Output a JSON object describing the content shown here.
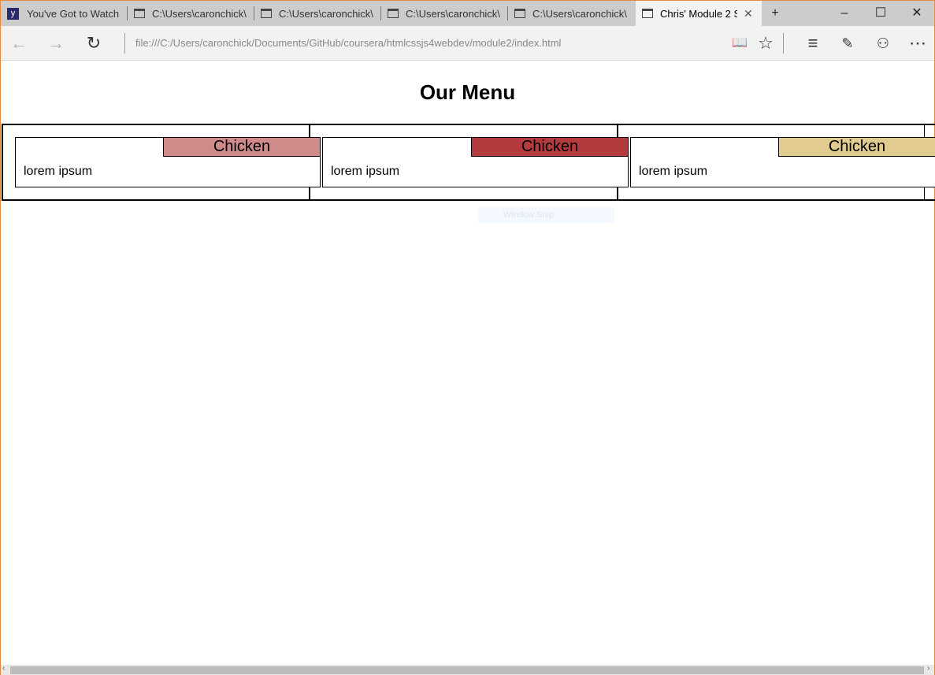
{
  "browser": {
    "tabs": [
      {
        "label": "You've Got to Watch",
        "icon": "site-favicon"
      },
      {
        "label": "C:\\Users\\caronchick\\",
        "icon": "window-icon"
      },
      {
        "label": "C:\\Users\\caronchick\\",
        "icon": "window-icon"
      },
      {
        "label": "C:\\Users\\caronchick\\",
        "icon": "window-icon"
      },
      {
        "label": "C:\\Users\\caronchick\\",
        "icon": "window-icon"
      },
      {
        "label": "Chris' Module 2 S",
        "icon": "window-icon",
        "active": true
      }
    ],
    "new_tab": "+",
    "window_controls": {
      "minimize": "–",
      "maximize": "☐",
      "close": "✕"
    },
    "url": "file:///C:/Users/caronchick/Documents/GitHub/coursera/htmlcssjs4webdev/module2/index.html",
    "nav_icons": {
      "back": "←",
      "forward": "→",
      "refresh": "↻",
      "reading": "📖",
      "favorite": "☆",
      "hub": "≡",
      "note": "✎",
      "share": "⚇",
      "more": "⋯"
    }
  },
  "page": {
    "title": "Our Menu",
    "items": [
      {
        "label": "Chicken",
        "text": "lorem ipsum",
        "color": "#cf8a8a"
      },
      {
        "label": "Chicken",
        "text": "lorem ipsum",
        "color": "#b33a3d"
      },
      {
        "label": "Chicken",
        "text": "lorem ipsum",
        "color": "#e2cb90"
      }
    ]
  },
  "overlay": {
    "snip_label": "Window Snip"
  }
}
